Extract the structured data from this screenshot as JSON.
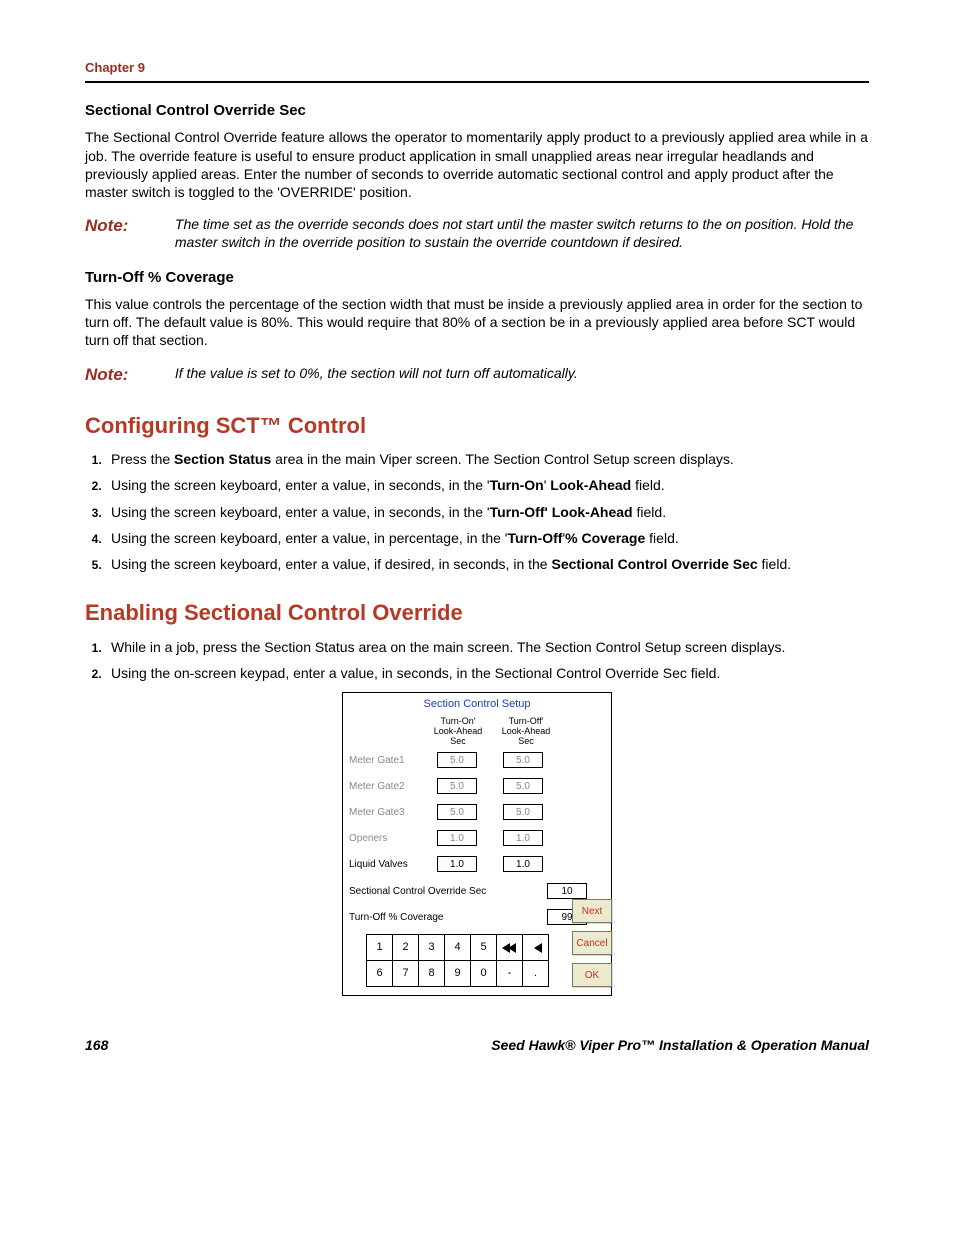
{
  "chapter": "Chapter 9",
  "section1": {
    "head": "Sectional Control Override Sec",
    "para": "The Sectional Control Override feature allows the operator to momentarily apply product to a previously applied area while in a job. The override feature is useful to ensure product application in small unapplied areas near irregular headlands and previously applied areas. Enter the number of seconds to override automatic sectional control and apply product after the master switch is toggled to the 'OVERRIDE' position.",
    "note_label": "Note:",
    "note_body": "The time set as the override seconds does not start until the master switch returns to the on position. Hold the master switch in the override position to sustain the override countdown if desired."
  },
  "section2": {
    "head": "Turn-Off % Coverage",
    "para": "This value controls the percentage of the section width that must be inside a previously applied area in order for the section to turn off. The default value is 80%. This would require that 80% of a section be in a previously applied area before SCT would turn off that section.",
    "note_label": "Note:",
    "note_body": "If the value is set to 0%, the section will not turn off automatically."
  },
  "config": {
    "title": "Configuring SCT™ Control",
    "steps": {
      "s1a": "Press the ",
      "s1b": "Section Status",
      "s1c": " area in the main Viper screen. The Section Control Setup screen displays.",
      "s2a": "Using the screen keyboard, enter a value, in seconds, in the '",
      "s2b": "Turn-On",
      "s2c": "' ",
      "s2d": "Look-Ahead",
      "s2e": " field.",
      "s3a": "Using the screen keyboard, enter a value, in seconds, in the '",
      "s3b": "Turn-Off' Look-Ahead",
      "s3c": " field.",
      "s4a": "Using the screen keyboard, enter a value, in percentage, in the '",
      "s4b": "Turn-Off",
      "s4c": "'",
      "s4d": "% Coverage",
      "s4e": " field.",
      "s5a": "Using the screen keyboard, enter a value, if desired, in seconds, in the ",
      "s5b": "Sectional Control Override Sec",
      "s5c": " field."
    }
  },
  "enable": {
    "title": "Enabling Sectional Control Override",
    "steps": {
      "s1": "While in a job, press the Section Status area on the main screen. The Section Control Setup screen displays.",
      "s2": "Using the on-screen keypad, enter a value, in seconds, in the Sectional Control Override Sec field."
    }
  },
  "scr": {
    "title": "Section Control Setup",
    "col_on_l1": "Turn-On'",
    "col_on_l2": "Look-Ahead",
    "col_on_l3": "Sec",
    "col_off_l1": "Turn-Off'",
    "col_off_l2": "Look-Ahead",
    "col_off_l3": "Sec",
    "rows": [
      {
        "label": "Meter Gate1",
        "on": "5.0",
        "off": "5.0",
        "active": false
      },
      {
        "label": "Meter Gate2",
        "on": "5.0",
        "off": "5.0",
        "active": false
      },
      {
        "label": "Meter Gate3",
        "on": "5.0",
        "off": "5.0",
        "active": false
      },
      {
        "label": "Openers",
        "on": "1.0",
        "off": "1.0",
        "active": false
      },
      {
        "label": "Liquid Valves",
        "on": "1.0",
        "off": "1.0",
        "active": true
      }
    ],
    "override_label": "Sectional Control Override Sec",
    "override_val": "10",
    "coverage_label": "Turn-Off % Coverage",
    "coverage_val": "99",
    "btn_next": "Next",
    "btn_cancel": "Cancel",
    "btn_ok": "OK",
    "keys": [
      "1",
      "2",
      "3",
      "4",
      "5",
      "⯬⯬",
      "⯬",
      "6",
      "7",
      "8",
      "9",
      "0",
      "-",
      "."
    ]
  },
  "footer": {
    "page": "168",
    "title": "Seed Hawk® Viper Pro™ Installation & Operation Manual"
  }
}
